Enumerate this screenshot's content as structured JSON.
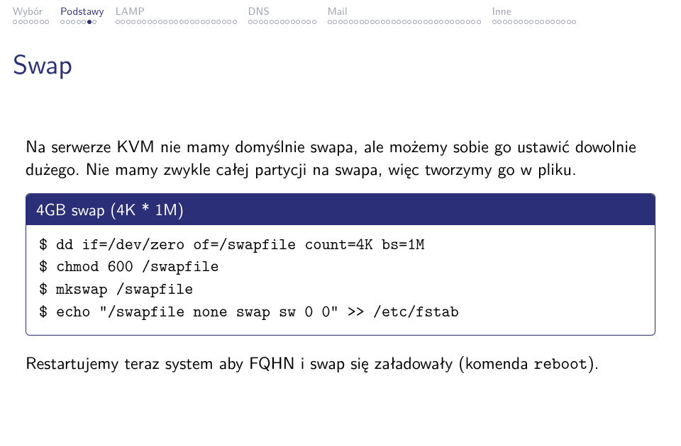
{
  "nav": [
    {
      "label": "Wybór",
      "active": false,
      "total": 7,
      "fill_start": -1,
      "fill_end": -1
    },
    {
      "label": "Podstawy",
      "active": true,
      "total": 7,
      "fill_start": 5,
      "fill_end": 5
    },
    {
      "label": "LAMP",
      "active": false,
      "total": 23,
      "fill_start": -1,
      "fill_end": -1
    },
    {
      "label": "DNS",
      "active": false,
      "total": 13,
      "fill_start": -1,
      "fill_end": -1
    },
    {
      "label": "Mail",
      "active": false,
      "total": 29,
      "fill_start": -1,
      "fill_end": -1
    },
    {
      "label": "Inne",
      "active": false,
      "total": 16,
      "fill_start": -1,
      "fill_end": -1
    }
  ],
  "title": "Swap",
  "para1": "Na serwerze KVM nie mamy domyślnie swapa, ale możemy sobie go ustawić dowolnie dużego. Nie mamy zwykle całej partycji na swapa, więc tworzymy go w pliku.",
  "block": {
    "title": "4GB swap (4K * 1M)",
    "lines": [
      "$ dd if=/dev/zero of=/swapfile count=4K bs=1M",
      "$ chmod 600 /swapfile",
      "$ mkswap /swapfile",
      "$ echo \"/swapfile none swap sw 0 0\" >> /etc/fstab"
    ]
  },
  "para2_pre": "Restartujemy teraz system aby FQHN i swap się załadowały (komenda ",
  "para2_tt": "reboot",
  "para2_post": ")."
}
